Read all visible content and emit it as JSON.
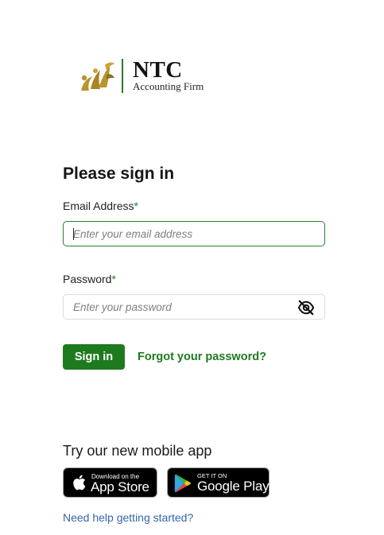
{
  "brand": {
    "name": "NTC",
    "subtitle": "Accounting Firm",
    "logo_icon": "ntc-figures-logo",
    "colors": {
      "logo_gold": "#b8952e",
      "divider_green": "#2d7a2a"
    }
  },
  "form": {
    "title": "Please sign in",
    "email": {
      "label": "Email Address",
      "required_mark": "*",
      "placeholder": "Enter your email address",
      "value": ""
    },
    "password": {
      "label": "Password",
      "required_mark": "*",
      "placeholder": "Enter your password",
      "value": "",
      "toggle_icon": "eye-slash-icon"
    },
    "submit_label": "Sign in",
    "forgot_label": "Forgot your password?"
  },
  "mobile": {
    "heading": "Try our new mobile app",
    "app_store": {
      "small_text": "Download on the",
      "big_text": "App Store",
      "icon": "apple-icon"
    },
    "google_play": {
      "small_text": "GET IT ON",
      "big_text": "Google Play",
      "icon": "google-play-icon"
    }
  },
  "help_link": "Need help getting started?",
  "colors": {
    "primary_green": "#1e7a1e",
    "link_blue": "#3565a8",
    "input_border": "#d9dde2",
    "focused_border": "#2f7d32"
  }
}
